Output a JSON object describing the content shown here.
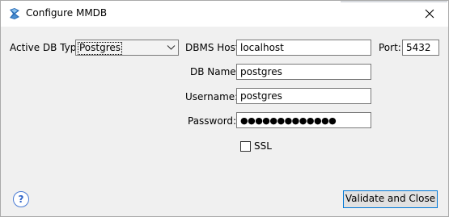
{
  "window": {
    "title": "Configure MMDB",
    "app_icon": "mmdb-app-icon",
    "close_icon": "close-x-icon"
  },
  "form": {
    "db_type": {
      "label": "Active DB Type:",
      "value": "Postgres",
      "icon": "chevron-down-icon"
    },
    "host": {
      "label": "DBMS Host:",
      "value": "localhost"
    },
    "port": {
      "label": "Port:",
      "value": "5432"
    },
    "db_name": {
      "label": "DB Name:",
      "value": "postgres"
    },
    "username": {
      "label": "Username:",
      "value": "postgres"
    },
    "password": {
      "label": "Password:",
      "value": "●●●●●●●●●●●●●"
    },
    "ssl": {
      "label": "SSL",
      "checked": false
    }
  },
  "footer": {
    "help_label": "?",
    "validate_label": "Validate and Close"
  },
  "colors": {
    "focus_border": "#0078d7",
    "help_blue": "#2f64c8",
    "window_bg": "#f0f0f0"
  }
}
